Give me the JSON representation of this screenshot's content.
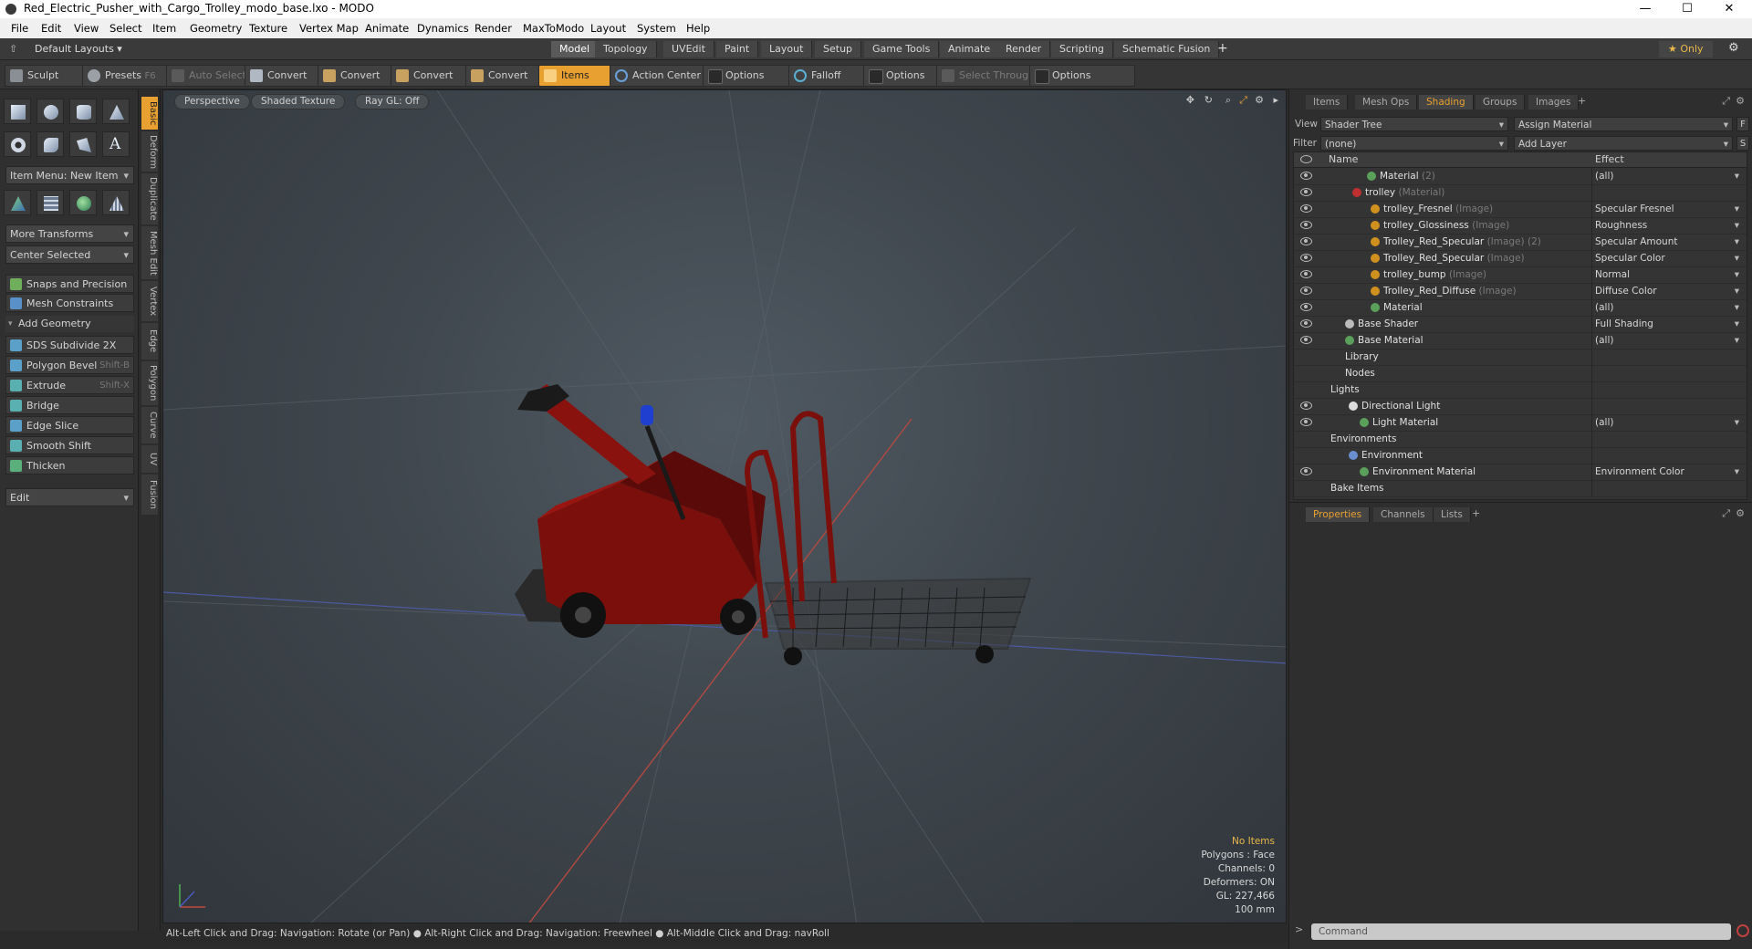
{
  "window": {
    "title": "Red_Electric_Pusher_with_Cargo_Trolley_modo_base.lxo - MODO",
    "minimize": "—",
    "maximize": "☐",
    "close": "✕"
  },
  "menu": [
    "File",
    "Edit",
    "View",
    "Select",
    "Item",
    "Geometry",
    "Texture",
    "Vertex Map",
    "Animate",
    "Dynamics",
    "Render",
    "MaxToModo",
    "Layout",
    "System",
    "Help"
  ],
  "layout_bar": {
    "default_layouts": "Default Layouts ▾",
    "tabs": [
      "Model",
      "Topology",
      "UVEdit",
      "Paint",
      "Layout",
      "Setup",
      "Game Tools",
      "Animate",
      "Render",
      "Scripting",
      "Schematic Fusion"
    ],
    "active_tab": "Model",
    "add": "+",
    "only": "★ Only",
    "gear": "⚙"
  },
  "tool_row": {
    "sculpt": "Sculpt",
    "presets": "Presets",
    "presets_shortcut": "F6",
    "auto_select": "Auto Select",
    "convert1": "Convert",
    "convert2": "Convert",
    "convert3": "Convert",
    "convert4": "Convert",
    "items": "Items",
    "action_center": "Action Center",
    "options1": "Options",
    "falloff": "Falloff",
    "options2": "Options",
    "select_through": "Select Through",
    "options3": "Options"
  },
  "left_panel": {
    "item_menu": "Item Menu: New Item",
    "more_transforms": "More Transforms",
    "center_selected": "Center Selected",
    "snaps": "Snaps and Precision",
    "mesh_constraints": "Mesh Constraints",
    "add_geometry": "Add Geometry",
    "tools": [
      {
        "label": "SDS Subdivide 2X",
        "shortcut": ""
      },
      {
        "label": "Polygon Bevel",
        "shortcut": "Shift-B"
      },
      {
        "label": "Extrude",
        "shortcut": "Shift-X"
      },
      {
        "label": "Bridge",
        "shortcut": ""
      },
      {
        "label": "Edge Slice",
        "shortcut": ""
      },
      {
        "label": "Smooth Shift",
        "shortcut": ""
      },
      {
        "label": "Thicken",
        "shortcut": ""
      }
    ],
    "edit": "Edit"
  },
  "vertical_tabs": [
    "Basic",
    "Deform",
    "Duplicate",
    "Mesh Edit",
    "Vertex",
    "Edge",
    "Polygon",
    "Curve",
    "UV",
    "Fusion"
  ],
  "viewport": {
    "perspective": "Perspective",
    "shaded_texture": "Shaded Texture",
    "ray_gl": "Ray GL: Off",
    "info": {
      "no_items": "No Items",
      "polygons": "Polygons : Face",
      "channels": "Channels: 0",
      "deformers": "Deformers: ON",
      "gl": "GL: 227,466",
      "scale": "100 mm"
    }
  },
  "status_bar": "Alt-Left Click and Drag: Navigation: Rotate (or Pan) ● Alt-Right Click and Drag: Navigation: Freewheel ● Alt-Middle Click and Drag: navRoll",
  "right_panel": {
    "tabs": [
      "Items",
      "Mesh Ops",
      "Shading",
      "Groups",
      "Images"
    ],
    "active_tab": "Shading",
    "add": "+",
    "view_label": "View",
    "view_value": "Shader Tree",
    "assign_material": "Assign Material",
    "f_btn": "F",
    "filter_label": "Filter",
    "filter_value": "(none)",
    "add_layer": "Add Layer",
    "s_btn": "S",
    "col_name": "Name",
    "col_effect": "Effect",
    "rows": [
      {
        "name": "Material",
        "type": "(2)",
        "effect": "(all)",
        "indent": 80,
        "dot": "#5aa05a",
        "eye": true
      },
      {
        "name": "trolley",
        "type": "(Material)",
        "effect": "",
        "indent": 64,
        "dot": "#c03030",
        "eye": true
      },
      {
        "name": "trolley_Fresnel",
        "type": "(Image)",
        "effect": "Specular Fresnel",
        "indent": 84,
        "dot": "#d09020",
        "eye": true
      },
      {
        "name": "trolley_Glossiness",
        "type": "(Image)",
        "effect": "Roughness",
        "indent": 84,
        "dot": "#d09020",
        "eye": true
      },
      {
        "name": "Trolley_Red_Specular",
        "type": "(Image) (2)",
        "effect": "Specular Amount",
        "indent": 84,
        "dot": "#d09020",
        "eye": true
      },
      {
        "name": "Trolley_Red_Specular",
        "type": "(Image)",
        "effect": "Specular Color",
        "indent": 84,
        "dot": "#d09020",
        "eye": true
      },
      {
        "name": "trolley_bump",
        "type": "(Image)",
        "effect": "Normal",
        "indent": 84,
        "dot": "#d09020",
        "eye": true
      },
      {
        "name": "Trolley_Red_Diffuse",
        "type": "(Image)",
        "effect": "Diffuse Color",
        "indent": 84,
        "dot": "#d09020",
        "eye": true
      },
      {
        "name": "Material",
        "type": "",
        "effect": "(all)",
        "indent": 84,
        "dot": "#5aa05a",
        "eye": true
      },
      {
        "name": "Base Shader",
        "type": "",
        "effect": "Full Shading",
        "indent": 56,
        "dot": "#bbbbbb",
        "eye": true
      },
      {
        "name": "Base Material",
        "type": "",
        "effect": "(all)",
        "indent": 56,
        "dot": "#5aa05a",
        "eye": true
      },
      {
        "name": "Library",
        "type": "",
        "effect": "",
        "indent": 56,
        "dot": "",
        "eye": false
      },
      {
        "name": "Nodes",
        "type": "",
        "effect": "",
        "indent": 56,
        "dot": "",
        "eye": false
      },
      {
        "name": "Lights",
        "type": "",
        "effect": "",
        "indent": 40,
        "dot": "",
        "eye": false
      },
      {
        "name": "Directional Light",
        "type": "",
        "effect": "",
        "indent": 60,
        "dot": "#dddddd",
        "eye": true
      },
      {
        "name": "Light Material",
        "type": "",
        "effect": "(all)",
        "indent": 72,
        "dot": "#5aa05a",
        "eye": true
      },
      {
        "name": "Environments",
        "type": "",
        "effect": "",
        "indent": 40,
        "dot": "",
        "eye": false
      },
      {
        "name": "Environment",
        "type": "",
        "effect": "",
        "indent": 60,
        "dot": "#6a8fd0",
        "eye": false
      },
      {
        "name": "Environment Material",
        "type": "",
        "effect": "Environment Color",
        "indent": 72,
        "dot": "#5aa05a",
        "eye": true
      },
      {
        "name": "Bake Items",
        "type": "",
        "effect": "",
        "indent": 40,
        "dot": "",
        "eye": false
      }
    ],
    "lower_tabs": [
      "Properties",
      "Channels",
      "Lists"
    ],
    "lower_active": "Properties",
    "command_placeholder": "Command"
  }
}
